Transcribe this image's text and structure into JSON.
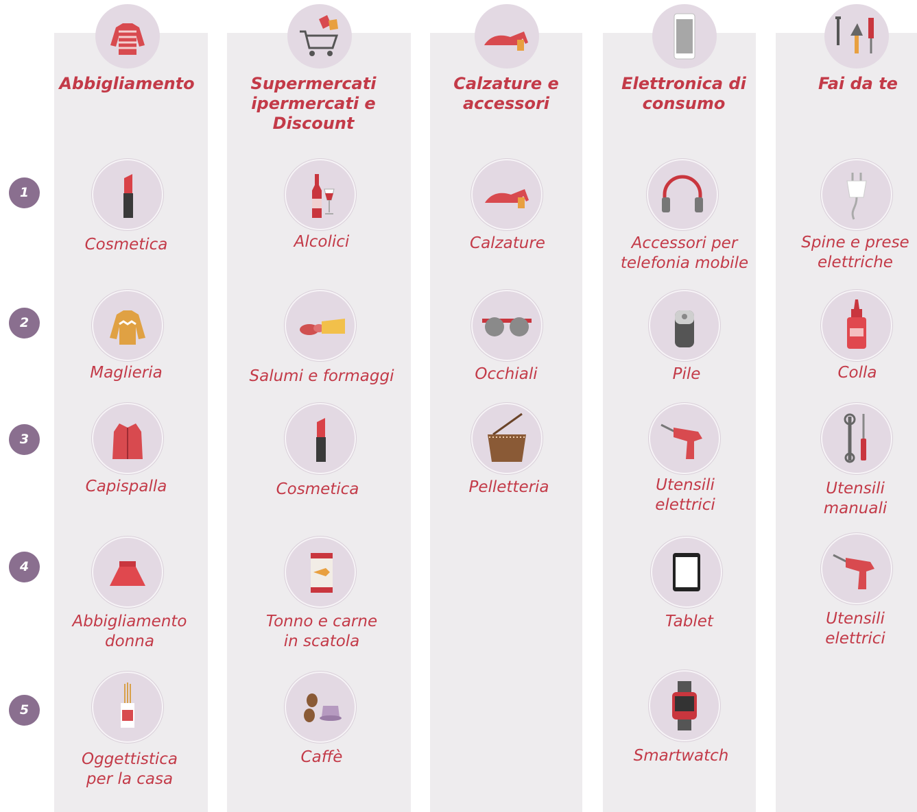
{
  "ranks": [
    "1",
    "2",
    "3",
    "4",
    "5"
  ],
  "columns": [
    {
      "title": "Abbigliamento",
      "icon": "sweater-icon",
      "items": [
        {
          "label": "Cosmetica",
          "icon": "lipstick-icon"
        },
        {
          "label": "Maglieria",
          "icon": "sweater-icon"
        },
        {
          "label": "Capispalla",
          "icon": "coat-icon"
        },
        {
          "label": "Abbigliamento\ndonna",
          "icon": "skirt-icon"
        },
        {
          "label": "Oggettistica\nper la casa",
          "icon": "diffuser-icon"
        }
      ]
    },
    {
      "title": "Supermercati\nipermercati e\nDiscount",
      "icon": "shopping-cart-icon",
      "items": [
        {
          "label": "Alcolici",
          "icon": "wine-icon"
        },
        {
          "label": "Salumi e formaggi",
          "icon": "salami-cheese-icon"
        },
        {
          "label": "Cosmetica",
          "icon": "lipstick-icon"
        },
        {
          "label": "Tonno e carne\nin scatola",
          "icon": "canned-fish-icon"
        },
        {
          "label": "Caffè",
          "icon": "coffee-icon"
        }
      ]
    },
    {
      "title": "Calzature\ne accessori",
      "icon": "shoe-icon",
      "items": [
        {
          "label": "Calzature",
          "icon": "shoe-icon"
        },
        {
          "label": "Occhiali",
          "icon": "glasses-icon"
        },
        {
          "label": "Pelletteria",
          "icon": "bag-icon"
        }
      ]
    },
    {
      "title": "Elettronica di\nconsumo",
      "icon": "smartphone-icon",
      "items": [
        {
          "label": "Accessori per\ntelefonia mobile",
          "icon": "headphones-icon"
        },
        {
          "label": "Pile",
          "icon": "battery-icon"
        },
        {
          "label": "Utensili\nelettrici",
          "icon": "drill-icon"
        },
        {
          "label": "Tablet",
          "icon": "tablet-icon"
        },
        {
          "label": "Smartwatch",
          "icon": "smartwatch-icon"
        }
      ]
    },
    {
      "title": "Fai da te",
      "icon": "tools-icon",
      "items": [
        {
          "label": "Spine e prese\nelettriche",
          "icon": "plug-icon"
        },
        {
          "label": "Colla",
          "icon": "glue-icon"
        },
        {
          "label": "Utensili\nmanuali",
          "icon": "screwdriver-wrench-icon"
        },
        {
          "label": "Utensili\nelettrici",
          "icon": "drill-icon"
        }
      ]
    }
  ],
  "colors": {
    "accent": "#c33a48",
    "rank_badge": "#8a6f8f",
    "column_bg": "#eeecee",
    "icon_bg": "#e3d9e3"
  }
}
